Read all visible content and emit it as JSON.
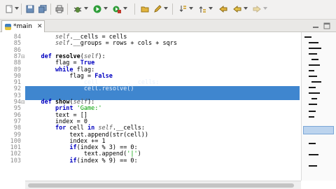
{
  "toolbar": {
    "icons": [
      "new-file-icon",
      "save-icon",
      "save-all-icon",
      "print-icon",
      "debug-icon",
      "run-icon",
      "external-tools-icon",
      "open-folder-icon",
      "pencil-icon",
      "next-annotation-icon",
      "prev-annotation-icon",
      "back-icon",
      "forward-icon"
    ]
  },
  "tab": {
    "label": "*main",
    "close": "✕"
  },
  "editor": {
    "lines": [
      {
        "n": "84",
        "t": "        self.__cells = cells"
      },
      {
        "n": "85",
        "t": "        self.__groups = rows + cols + sqrs"
      },
      {
        "n": "86",
        "t": ""
      },
      {
        "n": "87",
        "t": "    def resolve(self):"
      },
      {
        "n": "88",
        "t": "        flag = True"
      },
      {
        "n": "89",
        "t": "        while flag:"
      },
      {
        "n": "90",
        "t": "            flag = False"
      },
      {
        "n": "91",
        "t": "            for cell in self.__cells:"
      },
      {
        "n": "92",
        "t": "                cell.resolve()"
      },
      {
        "n": "93",
        "t": ""
      },
      {
        "n": "94",
        "t": "    def show(self):"
      },
      {
        "n": "95",
        "t": "        print 'Game:'"
      },
      {
        "n": "96",
        "t": "        text = []"
      },
      {
        "n": "97",
        "t": "        index = 0"
      },
      {
        "n": "98",
        "t": "        for cell in self.__cells:"
      },
      {
        "n": "99",
        "t": "            text.append(str(cell))"
      },
      {
        "n": "100",
        "t": "            index += 1"
      },
      {
        "n": "101",
        "t": "            if(index % 3) == 0:"
      },
      {
        "n": "102",
        "t": "                text.append('|')"
      },
      {
        "n": "103",
        "t": "            if(index % 9) == 0:"
      }
    ],
    "selected_lines": [
      "91",
      "92"
    ]
  },
  "colors": {
    "selection": "#3f86cf",
    "keyword": "#0000c0",
    "string": "#00a000"
  }
}
